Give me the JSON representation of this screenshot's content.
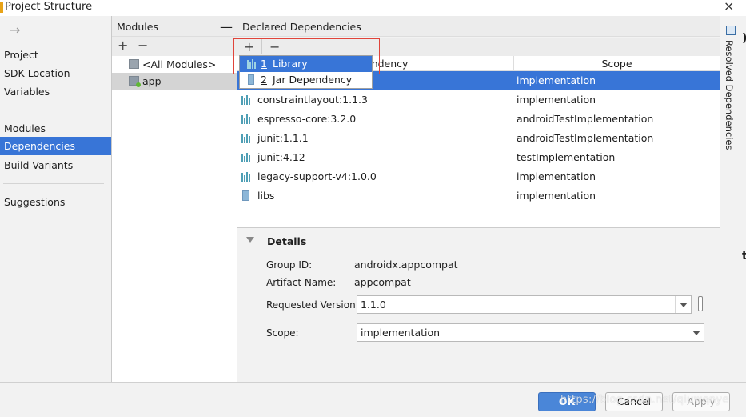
{
  "window": {
    "title": "Project Structure",
    "close": "×"
  },
  "nav": {
    "back": "→",
    "items": [
      {
        "label": "Project"
      },
      {
        "label": "SDK Location"
      },
      {
        "label": "Variables"
      },
      {
        "label": "Modules"
      },
      {
        "label": "Dependencies",
        "selected": true
      },
      {
        "label": "Build Variants"
      },
      {
        "label": "Suggestions"
      }
    ]
  },
  "modules": {
    "header": "Modules",
    "collapse": "—",
    "add": "+",
    "remove": "−",
    "rows": [
      {
        "label": "<All Modules>"
      },
      {
        "label": "app",
        "selected": true
      }
    ]
  },
  "dependencies": {
    "header": "Declared Dependencies",
    "add": "+",
    "remove": "−",
    "columns": [
      "endency",
      "Scope"
    ],
    "rows": [
      {
        "name": "",
        "scope": "implementation",
        "selected": true
      },
      {
        "name": "constraintlayout:1.1.3",
        "scope": "implementation"
      },
      {
        "name": "espresso-core:3.2.0",
        "scope": "androidTestImplementation"
      },
      {
        "name": "junit:1.1.1",
        "scope": "androidTestImplementation"
      },
      {
        "name": "junit:4.12",
        "scope": "testImplementation"
      },
      {
        "name": "legacy-support-v4:1.0.0",
        "scope": "implementation"
      },
      {
        "name": "libs",
        "scope": "implementation"
      }
    ]
  },
  "popup": {
    "items": [
      {
        "num": "1",
        "label": "Library Dependency",
        "selected": true
      },
      {
        "num": "2",
        "label": "Jar Dependency"
      }
    ]
  },
  "details": {
    "title": "Details",
    "group_id_label": "Group ID:",
    "group_id": "androidx.appcompat",
    "artifact_label": "Artifact Name:",
    "artifact": "appcompat",
    "version_label": "Requested Version:",
    "version": "1.1.0",
    "scope_label": "Scope:",
    "scope": "implementation"
  },
  "resolved": {
    "label": "Resolved Dependencies",
    "edge1": ")",
    "edge2": "t"
  },
  "buttons": {
    "ok": "OK",
    "cancel": "Cancel",
    "apply": "Apply"
  },
  "watermark": "https://blog.csdn.net/qiuwenye",
  "colors": {
    "selection": "#3875d7",
    "highlight_box": "#e0443a"
  }
}
